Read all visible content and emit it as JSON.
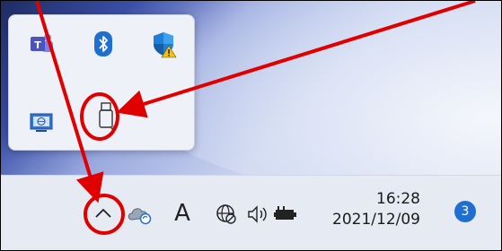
{
  "flyout": {
    "icons": [
      {
        "name": "teams-icon",
        "glyph": "T"
      },
      {
        "name": "bluetooth-icon",
        "glyph": "ᛒ"
      },
      {
        "name": "windows-security-warning-icon",
        "glyph": "!"
      },
      {
        "name": "remote-desktop-icon",
        "glyph": ""
      },
      {
        "name": "usb-drive-icon",
        "glyph": ""
      }
    ]
  },
  "taskbar": {
    "chevron_glyph": "⌃",
    "ime_label": "A",
    "clock_time": "16:28",
    "clock_date": "2021/12/09",
    "notification_count": "3"
  },
  "colors": {
    "annotation_red": "#e00000",
    "accent_blue": "#1f6fd1"
  }
}
